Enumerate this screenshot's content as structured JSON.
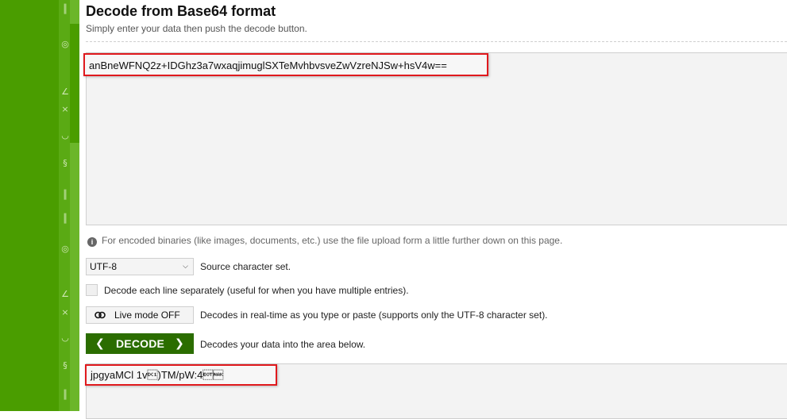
{
  "page": {
    "title": "Decode from Base64 format",
    "subtitle": "Simply enter your data then push the decode button."
  },
  "input": {
    "value": "anBneWFNQ2z+IDGhz3a7wxaqjimuglSXTeMvhbvsveZwVzreNJSw+hsV4w=="
  },
  "info": {
    "text": "For encoded binaries (like images, documents, etc.) use the file upload form a little further down on this page."
  },
  "charset": {
    "selected": "UTF-8",
    "label": "Source character set."
  },
  "decode_each_line": {
    "label": "Decode each line separately (useful for when you have multiple entries)."
  },
  "live_mode": {
    "button_label": "Live mode OFF",
    "description": "Decodes in real-time as you type or paste (supports only the UTF-8 character set)."
  },
  "decode": {
    "button_label": "DECODE",
    "description": "Decodes your data into the area below."
  },
  "output": {
    "value": "jpgyaMCl 1v\u0011)TM/pW:4\u0004\u0015"
  },
  "colors": {
    "sidebar": "#4a9d00",
    "decode_button": "#2b6d00",
    "highlight": "#e0191d"
  }
}
